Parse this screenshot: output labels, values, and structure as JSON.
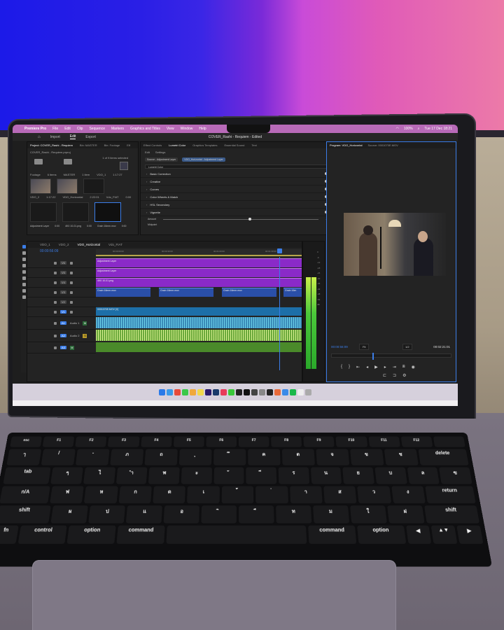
{
  "menubar": {
    "app": "Premiere Pro",
    "items": [
      "File",
      "Edit",
      "Clip",
      "Sequence",
      "Markers",
      "Graphics and Titles",
      "View",
      "Window",
      "Help"
    ],
    "battery": "100%",
    "clock": "Tue 17 Dec  18:21"
  },
  "titlebar": {
    "home_tabs": [
      "Import",
      "Edit",
      "Export"
    ],
    "title": "COVER_Rashi - Requiem - Edited"
  },
  "project_panel": {
    "tabs": [
      "Project: COVER_Rashi - Requiem",
      "Bin: MASTER",
      "Bin: Footage",
      "Eff"
    ],
    "file": "COVER_Rashi - Requiem.prproj",
    "selection": "1 of 9 items selected",
    "bins": [
      "Footage",
      "6 items",
      "MASTER",
      "1 item",
      "VDO_1",
      "1:17:27"
    ],
    "row1": [
      "VDO_2",
      "1:17:22",
      "VDO_Horizontal",
      "2:22:01",
      "Vdo_FIAT",
      "0:00"
    ],
    "row2": [
      "Adjustment Layer",
      "0:00",
      "4K0 10-01.png",
      "0:00",
      "Grain 16mm.mov",
      "0:00"
    ]
  },
  "lumetri": {
    "tabs": [
      "Effect Controls",
      "Lumetri Color",
      "Graphics Templates",
      "Essential Sound",
      "Text"
    ],
    "subtabs": [
      "Edit",
      "Settings"
    ],
    "source": "Source - Adjustment Layer",
    "target": "VDO_Horizontal - Adjustment Layer",
    "dropdown": "Lumetri Color",
    "sections": [
      "Basic Correction",
      "Creative",
      "Curves",
      "Color Wheels & Match",
      "HSL Secondary",
      "Vignette"
    ],
    "amount_label": "Amount",
    "amount_value": "-0.7",
    "midpoint_label": "Midpoint"
  },
  "program": {
    "tabs": [
      "Program: VDO_Horizontal",
      "Source: 0001070E.MOV"
    ],
    "timecode": "00:00:56:09",
    "fit": "Fit",
    "resolution": "1/2",
    "duration": "00:02:21:01",
    "playhead_fraction": 0.34
  },
  "timeline": {
    "tabs": [
      "VDO_1",
      "VDO_2",
      "VDO_Horizontal",
      "Vdo_FIAT"
    ],
    "timecode": "00:00:56:09",
    "ruler": [
      "00:00:00:00",
      "00:00:30:00",
      "00:01:00:00",
      "00:01:30:00"
    ],
    "tracks": [
      "V6",
      "V5",
      "V4",
      "V3",
      "V2",
      "V1",
      "A1",
      "A2",
      "A3"
    ],
    "audio_labels": [
      "Audio 1",
      "Audio 2"
    ],
    "clips": {
      "adj1": "Adjustment Layer",
      "adj2": "Adjustment Layer",
      "png": "4K0 10-01.png",
      "grain1": "Grain 16mm.mov",
      "grain2": "Grain 16mm.mov",
      "grain3": "Grain 16mm.mov",
      "grain4": "Grain 16m",
      "video": "0001070E.MOV [V]"
    }
  },
  "meter": {
    "scale": [
      "0",
      "-6",
      "-12",
      "-18",
      "-24",
      "-30",
      "-36",
      "-42",
      "-48",
      "-54",
      "dB"
    ],
    "left_level": 0.73,
    "right_level": 0.73
  },
  "dock": {
    "apps": [
      "Finder",
      "Safari",
      "Chrome",
      "Messages",
      "Photos",
      "Notes",
      "Premiere",
      "Lightroom",
      "Music",
      "LINE",
      "Live",
      "CapCut",
      "DaVinci",
      "Settings",
      "Logic",
      "Arc",
      "Apps",
      "Spotify",
      "Preview",
      "Trash"
    ]
  },
  "keyboard": {
    "fn_row": [
      "esc",
      "F1",
      "F2",
      "F3",
      "F4",
      "F5",
      "F6",
      "F7",
      "F8",
      "F9",
      "F10",
      "F11",
      "F12",
      ""
    ],
    "row1": [
      "ๅ",
      "/",
      "-",
      "ภ",
      "ถ",
      "ุ",
      "ึ",
      "ค",
      "ต",
      "จ",
      "ข",
      "ช",
      "delete"
    ],
    "row2": [
      "tab",
      "ๆ",
      "ไ",
      "ำ",
      "พ",
      "ะ",
      "ั",
      "ี",
      "ร",
      "น",
      "ย",
      "บ",
      "ล",
      "ฃ"
    ],
    "row3": [
      "ก/A",
      "ฟ",
      "ห",
      "ก",
      "ด",
      "เ",
      "้",
      "่",
      "า",
      "ส",
      "ว",
      "ง",
      "return"
    ],
    "row4": [
      "shift",
      "ผ",
      "ป",
      "แ",
      "อ",
      "ิ",
      "ื",
      "ท",
      "ม",
      "ใ",
      "ฝ",
      "shift"
    ],
    "row5": [
      "fn",
      "control",
      "option",
      "command",
      "",
      "command",
      "option",
      "◀",
      "▲▼",
      "▶"
    ]
  }
}
